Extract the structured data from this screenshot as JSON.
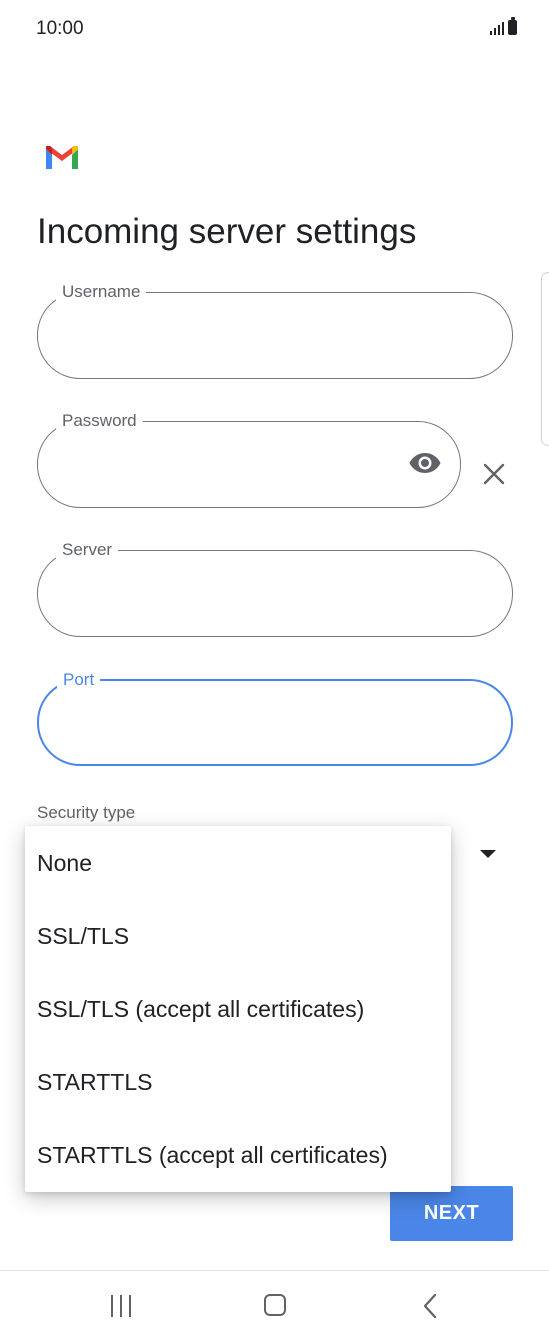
{
  "status_bar": {
    "time": "10:00"
  },
  "page": {
    "title": "Incoming server settings"
  },
  "fields": {
    "username": {
      "label": "Username",
      "value": ""
    },
    "password": {
      "label": "Password",
      "value": ""
    },
    "server": {
      "label": "Server",
      "value": ""
    },
    "port": {
      "label": "Port",
      "value": ""
    }
  },
  "security": {
    "label": "Security type",
    "options": [
      "None",
      "SSL/TLS",
      "SSL/TLS (accept all certificates)",
      "STARTTLS",
      "STARTTLS (accept all certificates)"
    ]
  },
  "actions": {
    "next_label": "NEXT"
  },
  "colors": {
    "accent": "#4a86e8",
    "outline": "#75777a",
    "text": "#202124",
    "muted": "#5f6368"
  },
  "icons": {
    "logo": "gmail-logo",
    "password_toggle": "eye-icon",
    "clear": "close-icon",
    "dropdown": "caret-down-icon",
    "nav_recents": "recents-icon",
    "nav_home": "home-icon",
    "nav_back": "back-icon"
  }
}
